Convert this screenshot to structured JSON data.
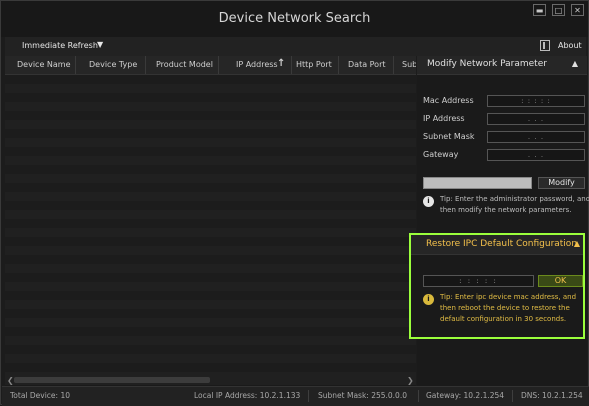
{
  "window": {
    "title": "Device Network Search",
    "controls": {
      "minimize": "▬",
      "maximize": "□",
      "close": "✕"
    }
  },
  "toolbar": {
    "refresh_label": "Immediate Refresh",
    "refresh_caret": "▼",
    "about_label": "About"
  },
  "table": {
    "columns": [
      "Device Name",
      "Device Type",
      "Product Model",
      "IP Address",
      "Http Port",
      "Data Port",
      "Sub"
    ],
    "sort_indicator": "↑",
    "rows": []
  },
  "modify_panel": {
    "title": "Modify Network Parameter",
    "collapse_glyph": "▲",
    "fields": [
      {
        "label": "Mac Address",
        "value": ":  :  :  :  :"
      },
      {
        "label": "IP Address",
        "value": ".  .  ."
      },
      {
        "label": "Subnet Mask",
        "value": ".  .  ."
      },
      {
        "label": "Gateway",
        "value": ".  .  ."
      }
    ],
    "password_value": "",
    "modify_label": "Modify",
    "tip_line1": "Tip: Enter the administrator password, and",
    "tip_line2": "then modify the network parameters."
  },
  "restore_panel": {
    "title": "Restore IPC Default Configuration",
    "collapse_glyph": "▲",
    "mac_value": ":  :  :  :  :",
    "ok_label": "OK",
    "tip_line1": "Tip: Enter ipc device mac address, and",
    "tip_line2": "then reboot the device to restore the",
    "tip_line3": "default configuration in 30 seconds.",
    "highlight_color": "#9bff3c",
    "accent_color": "#f3c04b"
  },
  "status_bar": {
    "total": "Total Device: 10",
    "local_ip": "Local IP Address: 10.2.1.133",
    "subnet": "Subnet Mask: 255.0.0.0",
    "gateway": "Gateway: 10.2.1.254",
    "dns": "DNS: 10.2.1.254"
  }
}
